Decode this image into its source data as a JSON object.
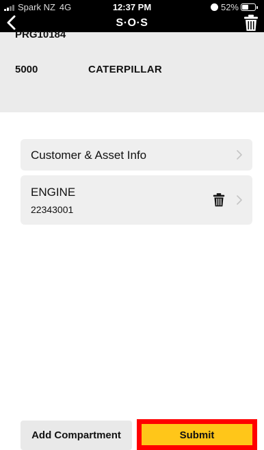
{
  "status_bar": {
    "carrier": "Spark NZ",
    "network": "4G",
    "time": "12:37 PM",
    "battery": "52%",
    "battery_level": 0.52
  },
  "nav": {
    "title": "S·O·S",
    "back_icon": "chevron-left-icon",
    "delete_icon": "trash-icon"
  },
  "header": {
    "id": "PRG10184",
    "model": "5000",
    "make": "CATERPILLAR"
  },
  "list": {
    "items": [
      {
        "label": "Customer & Asset Info"
      },
      {
        "label": "ENGINE",
        "sub": "22343001"
      }
    ]
  },
  "actions": {
    "add_label": "Add Compartment",
    "submit_label": "Submit"
  },
  "colors": {
    "bar": "#000000",
    "panel": "#ebebeb",
    "card": "#efefef",
    "submit": "#ffc619",
    "highlight": "#ff0000"
  }
}
